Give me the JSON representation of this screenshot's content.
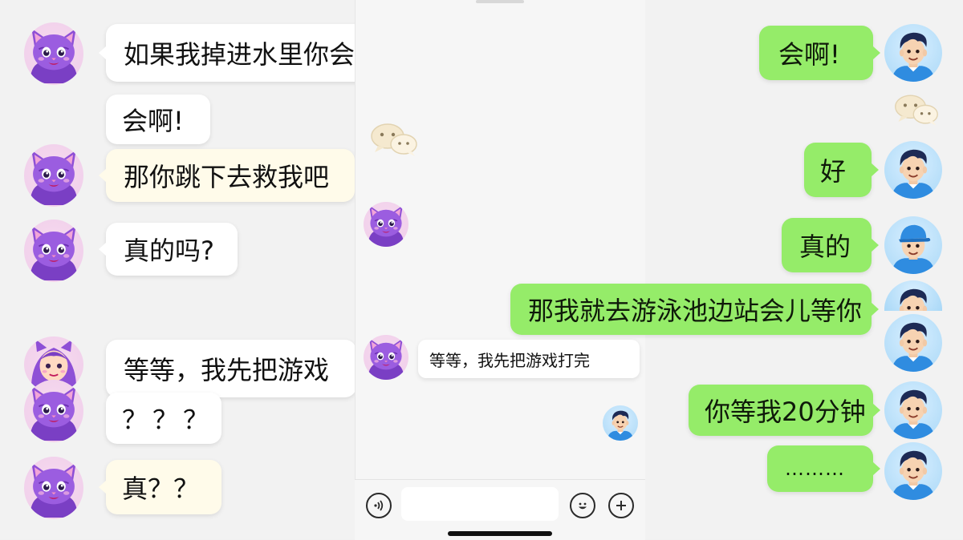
{
  "left_chat": {
    "messages": [
      {
        "text": "如果我掉进水里你会救我吗?"
      },
      {
        "text": "会啊!"
      },
      {
        "text": "那你跳下去救我吧"
      },
      {
        "text": "真的吗?"
      },
      {
        "text": "等等，我先把游戏"
      },
      {
        "text": "？？？"
      },
      {
        "text": "真？？"
      }
    ]
  },
  "middle_chat": {
    "messages": [
      {
        "text": "等等，我先把游戏打完"
      }
    ],
    "input_placeholder": "",
    "voice_icon": "voice-icon",
    "emoji_icon": "emoji-icon",
    "add_icon": "plus-icon"
  },
  "right_chat": {
    "messages": [
      {
        "text": "会啊!"
      },
      {
        "text": "好"
      },
      {
        "text": "真的"
      },
      {
        "text": "那我就去游泳池边站会儿等你"
      },
      {
        "text": "你等我20分钟"
      },
      {
        "text": "………"
      }
    ]
  },
  "colors": {
    "green_bubble": "#95ec69",
    "white_bubble": "#ffffff",
    "cream_bubble": "#fffbea",
    "cat_fur": "#8e4fd6",
    "boy_shirt": "#2f8ce0"
  }
}
